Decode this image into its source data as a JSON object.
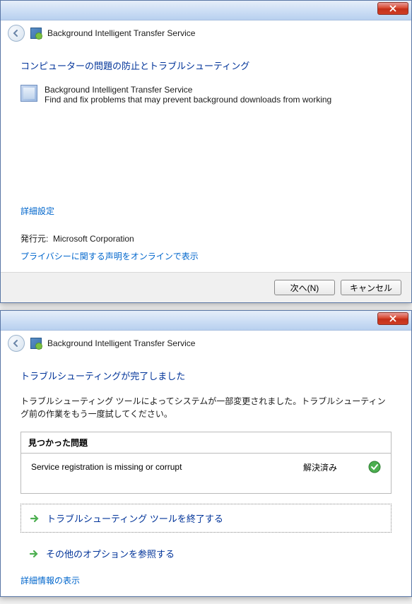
{
  "window1": {
    "nav_title": "Background Intelligent Transfer Service",
    "heading": "コンピューターの問題の防止とトラブルシューティング",
    "item": {
      "title": "Background Intelligent Transfer Service",
      "desc": "Find and fix problems that may prevent background downloads from working"
    },
    "advanced_link": "詳細設定",
    "publisher_label": "発行元:",
    "publisher_value": "Microsoft Corporation",
    "privacy_link": "プライバシーに関する声明をオンラインで表示",
    "buttons": {
      "next": "次へ(N)",
      "cancel": "キャンセル"
    }
  },
  "window2": {
    "nav_title": "Background Intelligent Transfer Service",
    "heading": "トラブルシューティングが完了しました",
    "body": "トラブルシューティング ツールによってシステムが一部変更されました。トラブルシューティング前の作業をもう一度試してください。",
    "found": {
      "header": "見つかった問題",
      "problem": "Service registration is missing or corrupt",
      "status": "解決済み"
    },
    "actions": {
      "close": "トラブルシューティング ツールを終了する",
      "other": "その他のオプションを参照する"
    },
    "details_link": "詳細情報の表示"
  }
}
